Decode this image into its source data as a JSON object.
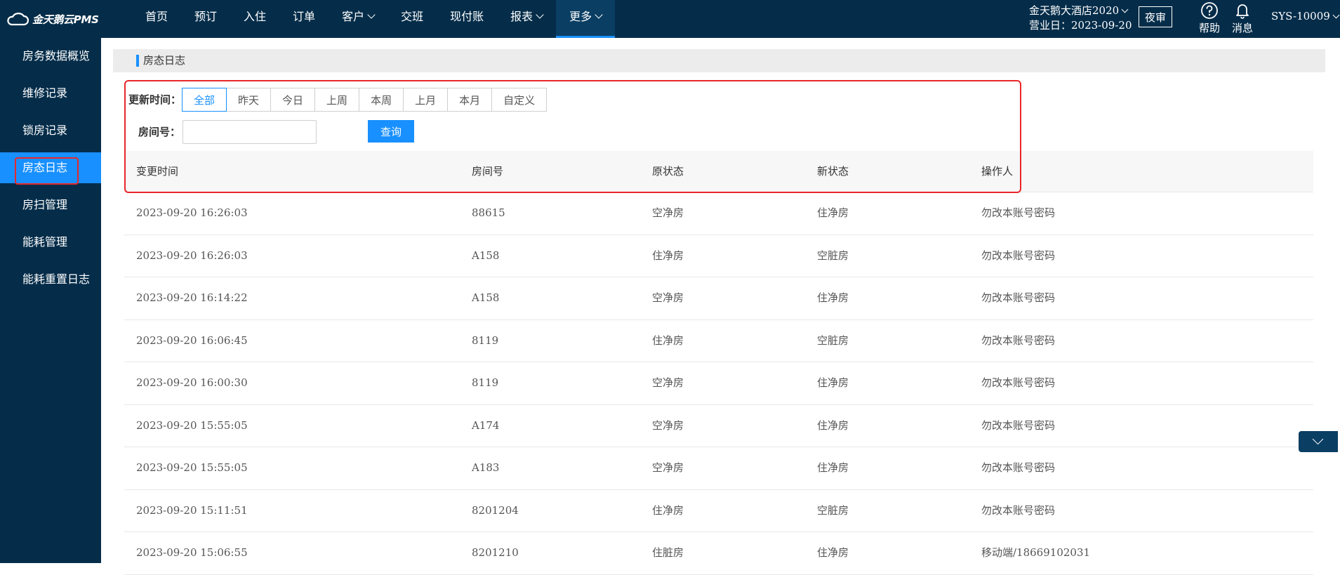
{
  "app": {
    "logo_text": "金天鹅云PMS",
    "brand_color": "#052d4a",
    "accent_color": "#1890ff",
    "highlight_color": "#e8272a"
  },
  "nav": {
    "items": [
      {
        "label": "首页"
      },
      {
        "label": "预订"
      },
      {
        "label": "入住"
      },
      {
        "label": "订单"
      },
      {
        "label": "客户"
      },
      {
        "label": "交班"
      },
      {
        "label": "现付账"
      },
      {
        "label": "报表"
      },
      {
        "label": "更多"
      }
    ],
    "active": "更多"
  },
  "header_right": {
    "hotel_name": "金天鹅大酒店2020",
    "business_day": "营业日：2023-09-20",
    "night_audit": "夜审",
    "help_label": "帮助",
    "help_icon": "question-circle-icon",
    "message_label": "消息",
    "message_icon": "bell-icon",
    "user": "SYS-10009"
  },
  "sidebar": {
    "items": [
      {
        "label": "房务数据概览"
      },
      {
        "label": "维修记录"
      },
      {
        "label": "锁房记录"
      },
      {
        "label": "房态日志"
      },
      {
        "label": "房扫管理"
      },
      {
        "label": "能耗管理"
      },
      {
        "label": "能耗重置日志"
      }
    ],
    "active": "房态日志"
  },
  "page": {
    "title": "房态日志"
  },
  "filters": {
    "update_time_label": "更新时间：",
    "time_options": [
      "全部",
      "昨天",
      "今日",
      "上周",
      "本周",
      "上月",
      "本月",
      "自定义"
    ],
    "selected_time": "全部",
    "room_label": "房间号：",
    "room_value": "",
    "room_placeholder": "",
    "query_button": "查询"
  },
  "table": {
    "columns": [
      "变更时间",
      "房间号",
      "原状态",
      "新状态",
      "操作人"
    ],
    "rows": [
      [
        "2023-09-20 16:26:03",
        "88615",
        "空净房",
        "住净房",
        "勿改本账号密码"
      ],
      [
        "2023-09-20 16:26:03",
        "A158",
        "住净房",
        "空脏房",
        "勿改本账号密码"
      ],
      [
        "2023-09-20 16:14:22",
        "A158",
        "空净房",
        "住净房",
        "勿改本账号密码"
      ],
      [
        "2023-09-20 16:06:45",
        "8119",
        "住净房",
        "空脏房",
        "勿改本账号密码"
      ],
      [
        "2023-09-20 16:00:30",
        "8119",
        "空净房",
        "住净房",
        "勿改本账号密码"
      ],
      [
        "2023-09-20 15:55:05",
        "A174",
        "空净房",
        "住净房",
        "勿改本账号密码"
      ],
      [
        "2023-09-20 15:55:05",
        "A183",
        "空净房",
        "住净房",
        "勿改本账号密码"
      ],
      [
        "2023-09-20 15:11:51",
        "8201204",
        "住净房",
        "空脏房",
        "勿改本账号密码"
      ],
      [
        "2023-09-20 15:06:55",
        "8201210",
        "住脏房",
        "住净房",
        "移动端/18669102031"
      ]
    ]
  }
}
